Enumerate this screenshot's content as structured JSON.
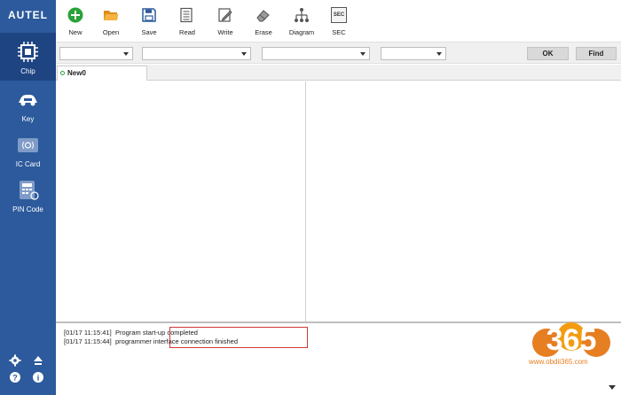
{
  "app": {
    "brand": "AUTEL",
    "window_controls": [
      "—",
      "□",
      "✕"
    ]
  },
  "sidebar": {
    "items": [
      {
        "label": "Chip",
        "icon": "chip-icon",
        "active": true
      },
      {
        "label": "Key",
        "icon": "car-key-icon",
        "active": false
      },
      {
        "label": "IC Card",
        "icon": "ic-card-icon",
        "active": false
      },
      {
        "label": "PIN Code",
        "icon": "pin-code-icon",
        "active": false
      }
    ],
    "bottom_icons": [
      "gear-icon",
      "upload-icon",
      "help-icon",
      "info-icon"
    ]
  },
  "toolbar": {
    "tools": [
      {
        "label": "New",
        "icon": "plus-circle-icon"
      },
      {
        "label": "Open",
        "icon": "folder-icon"
      },
      {
        "label": "Save",
        "icon": "floppy-disk-icon"
      },
      {
        "label": "Read",
        "icon": "read-icon"
      },
      {
        "label": "Write",
        "icon": "write-icon"
      },
      {
        "label": "Erase",
        "icon": "eraser-icon"
      },
      {
        "label": "Diagram",
        "icon": "diagram-icon"
      },
      {
        "label": "SEC",
        "icon": "sec-icon"
      }
    ],
    "sec_badge": "SEC"
  },
  "filters": {
    "combos": [
      "",
      "",
      "",
      ""
    ],
    "ok_label": "OK",
    "find_label": "Find"
  },
  "tabs": [
    {
      "label": "New0"
    }
  ],
  "log": {
    "lines": [
      {
        "time": "[01/17 11:15:41]",
        "message": "Program start-up completed"
      },
      {
        "time": "[01/17 11:15:44]",
        "message": "programmer interface connection finished"
      }
    ]
  },
  "watermark": {
    "logo": "365",
    "url": "www.obdii365.com"
  },
  "colors": {
    "sidebar": "#2c5a9c",
    "sidebar_active": "#1e4482",
    "new_green": "#2aa339",
    "open_orange": "#f0a030",
    "save_blue": "#2c5a9c",
    "log_box_red": "#d03a3a",
    "watermark_orange": "#e67e22"
  }
}
